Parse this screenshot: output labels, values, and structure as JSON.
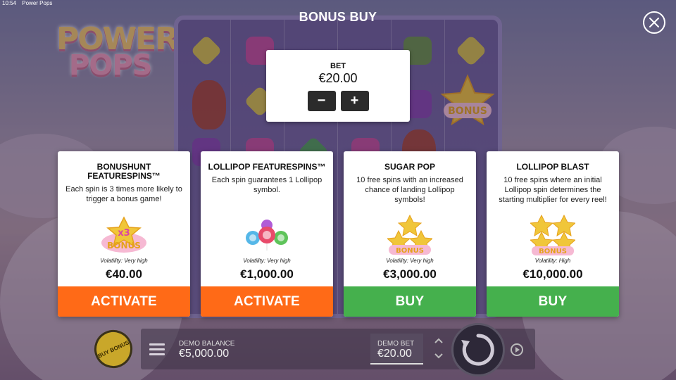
{
  "system_bar": {
    "time": "10:54",
    "window_title": "Power Pops"
  },
  "logo": {
    "line1": "POWER",
    "line2": "POPS"
  },
  "background_symbol": {
    "bonus": "BONUS"
  },
  "dialog": {
    "title": "BONUS BUY",
    "close_icon": "close-icon"
  },
  "bet": {
    "label": "BET",
    "value": "€20.00",
    "minus": "−",
    "plus": "+"
  },
  "options": [
    {
      "title": "BONUSHUNT FEATURESPINS™",
      "description": "Each spin is 3 times more likely to trigger a bonus game!",
      "art_text_1": "x3",
      "art_text_2": "BONUS",
      "volatility": "Volatility: Very high",
      "price": "€40.00",
      "action": "ACTIVATE",
      "action_color": "#ff6a17"
    },
    {
      "title": "LOLLIPOP FEATURESPINS™",
      "description": "Each spin guarantees 1 Lollipop symbol.",
      "volatility": "Volatility: Very high",
      "price": "€1,000.00",
      "action": "ACTIVATE",
      "action_color": "#ff6a17"
    },
    {
      "title": "SUGAR POP",
      "description": "10 free spins with an increased chance of landing Lollipop symbols!",
      "art_text": "BONUS",
      "volatility": "Volatility: Very high",
      "price": "€3,000.00",
      "action": "BUY",
      "action_color": "#45b04d"
    },
    {
      "title": "LOLLIPOP BLAST",
      "description": "10 free spins where an initial Lollipop spin determines the starting multiplier for every reel!",
      "art_text": "BONUS",
      "volatility": "Volatility: High",
      "price": "€10,000.00",
      "action": "BUY",
      "action_color": "#45b04d"
    }
  ],
  "bottom": {
    "buy_bonus": "BUY BONUS",
    "demo_balance_label": "DEMO BALANCE",
    "demo_balance_value": "€5,000.00",
    "demo_bet_label": "DEMO BET",
    "demo_bet_value": "€20.00"
  }
}
